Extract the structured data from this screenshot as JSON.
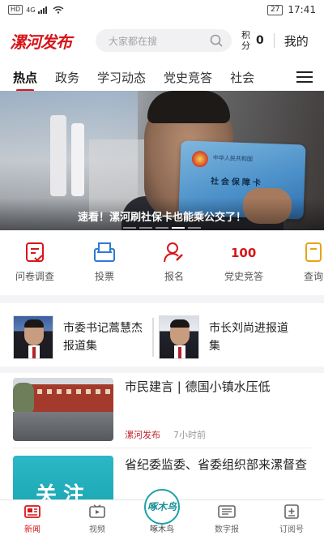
{
  "status_bar": {
    "hd": "HD",
    "net": "4G",
    "battery": "27",
    "time": "17:41"
  },
  "header": {
    "logo": "漯河发布",
    "search_placeholder": "大家都在搜",
    "points_label": "积分",
    "points_value": "0",
    "mine": "我的"
  },
  "tabs": [
    "热点",
    "政务",
    "学习动态",
    "党史竞答",
    "社会"
  ],
  "banner": {
    "caption": "速看！漯河刷社保卡也能乘公交了！",
    "card_title": "中华人民共和国",
    "card_name": "社会保障卡"
  },
  "quick": [
    {
      "label": "问卷调查",
      "icon": "survey-icon",
      "color": "#d7161a"
    },
    {
      "label": "投票",
      "icon": "vote-icon",
      "color": "#2e7bd6"
    },
    {
      "label": "报名",
      "icon": "signup-icon",
      "color": "#d7161a"
    },
    {
      "label": "党史竞答",
      "icon": "party-100-icon",
      "color": "#d7161a"
    },
    {
      "label": "查询",
      "icon": "query-icon",
      "color": "#e8a317"
    }
  ],
  "features": [
    {
      "label": "市委书记蒿慧杰报道集"
    },
    {
      "label": "市长刘尚进报道集"
    }
  ],
  "news": [
    {
      "title": "市民建言 | 德国小镇水压低",
      "source": "漯河发布",
      "time": "7小时前"
    },
    {
      "title": "省纪委监委、省委组织部来漯督查",
      "thumb_text": "关注"
    }
  ],
  "bottom_nav": [
    {
      "label": "新闻",
      "icon": "news-icon"
    },
    {
      "label": "视频",
      "icon": "video-icon"
    },
    {
      "label": "啄木鸟",
      "icon": "woodpecker-icon",
      "badge": "啄木鸟"
    },
    {
      "label": "数字报",
      "icon": "newspaper-icon"
    },
    {
      "label": "订阅号",
      "icon": "subscribe-icon"
    }
  ]
}
